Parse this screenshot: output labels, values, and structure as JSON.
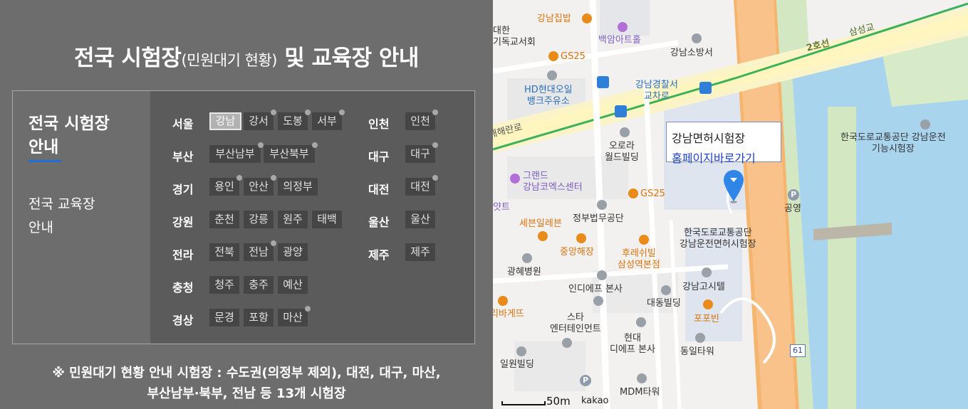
{
  "title": {
    "main_a": "전국 시험장",
    "main_b": "(민원대기 현황)",
    "main_c": " 및 교육장 안내"
  },
  "tabs": {
    "exam_sites": "전국 시험장 안내",
    "edu_sites_line1": "전국 교육장",
    "edu_sites_line2": "안내"
  },
  "regions": {
    "seoul": {
      "label": "서울",
      "sites": [
        "강남",
        "강서",
        "도봉",
        "서부"
      ]
    },
    "busan": {
      "label": "부산",
      "sites": [
        "부산남부",
        "부산북부"
      ]
    },
    "gyeonggi": {
      "label": "경기",
      "sites": [
        "용인",
        "안산",
        "의정부"
      ]
    },
    "gangwon": {
      "label": "강원",
      "sites": [
        "춘천",
        "강릉",
        "원주",
        "태백"
      ]
    },
    "jeolla": {
      "label": "전라",
      "sites": [
        "전북",
        "전남",
        "광양"
      ]
    },
    "chungcheong": {
      "label": "충청",
      "sites": [
        "청주",
        "충주",
        "예산"
      ]
    },
    "gyeongsang": {
      "label": "경상",
      "sites": [
        "문경",
        "포항",
        "마산"
      ]
    },
    "incheon": {
      "label": "인천",
      "sites": [
        "인천"
      ]
    },
    "daegu": {
      "label": "대구",
      "sites": [
        "대구"
      ]
    },
    "daejeon": {
      "label": "대전",
      "sites": [
        "대전"
      ]
    },
    "ulsan": {
      "label": "울산",
      "sites": [
        "울산"
      ]
    },
    "jeju": {
      "label": "제주",
      "sites": [
        "제주"
      ]
    }
  },
  "note": {
    "line1": "※ 민원대기 현황 안내 시험장 : 수도권(의정부 제외), 대전, 대구, 마산,",
    "line2": "부산남부·북부, 전남 등 13개 시험장"
  },
  "map": {
    "infobox_title": "강남면허시험장",
    "infobox_link": "홈페이지바로가기",
    "scale": "50m",
    "provider": "kakao",
    "road_route": "2호선",
    "road_num": "61",
    "labels": {
      "gangnam_jipbap": "강남집밥",
      "daehan_church": "대한\n기독교서회",
      "baekam": "백암아트홀",
      "gangnam_fire": "강남소방서",
      "gs25_a": "GS25",
      "hd_oil": "HD현대오일\n뱅크주유소",
      "police": "강남경찰서\n교차로",
      "samseong": "삼성교",
      "haean_ro": "해해란로",
      "orora": "오로라\n월드빌딩",
      "grand": "그랜드\n강남코엑스센터",
      "gs25_b": "GS25",
      "seven": "세븐일레븐",
      "law": "정부법무공단",
      "traffic_a": "한국도로교통공단\n강남운전면허시험장",
      "traffic_b": "한국도로교통공단 강남운전\n기능시험장",
      "gongyeong": "공영",
      "jungang": "중앙해장",
      "hurei": "후레쉬빌\n삼성역본점",
      "kwanghye": "광혜병원",
      "indi": "인디에프 본사",
      "gangnam_gosi": "강남고시텔",
      "daedong": "대동빌딩",
      "paris": "리바게뜨",
      "star": "스타\n엔터테인먼트",
      "popobin": "포포빈",
      "hyundai": "현대\n디에프 본사",
      "dongil": "동일타워",
      "ilwon": "일원빌딩",
      "mdm": "MDM타워",
      "yat": "얏트"
    }
  }
}
